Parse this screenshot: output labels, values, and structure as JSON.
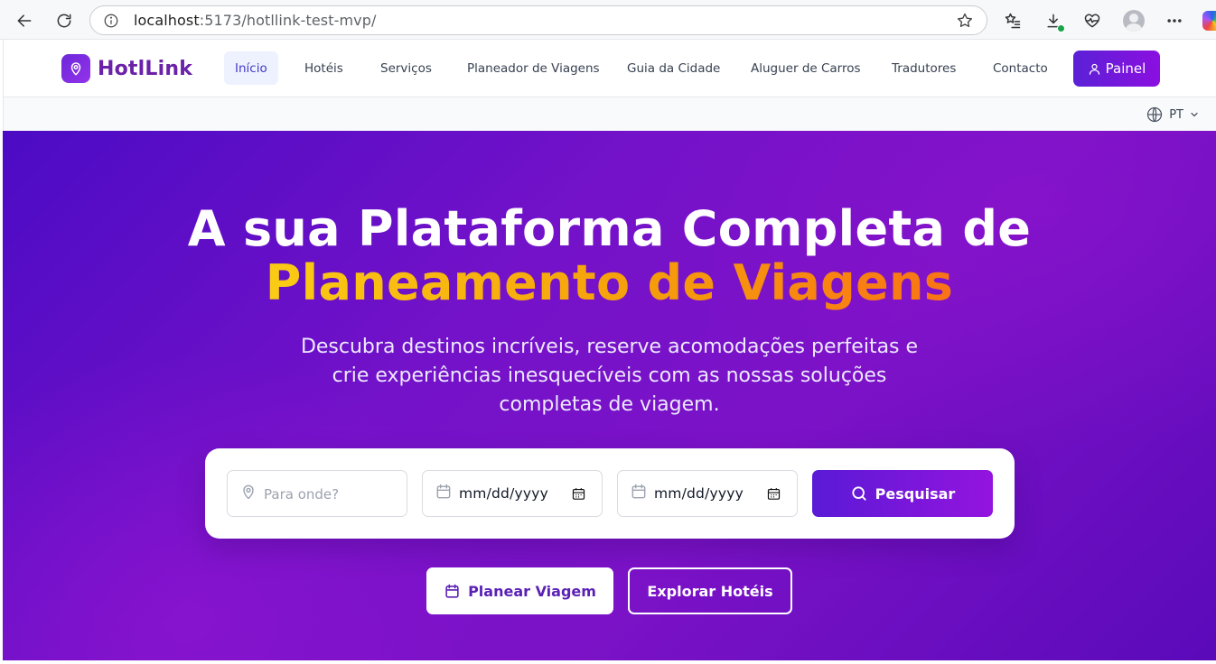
{
  "browser": {
    "url_host": "localhost",
    "url_path": ":5173/hotllink-test-mvp/"
  },
  "navbar": {
    "brand": "HotlLink",
    "links": [
      {
        "label": "Início",
        "active": true
      },
      {
        "label": "Hotéis",
        "active": false
      },
      {
        "label": "Serviços",
        "active": false
      },
      {
        "label": "Planeador de Viagens",
        "active": false
      },
      {
        "label": "Guia da Cidade",
        "active": false
      },
      {
        "label": "Aluguer de Carros",
        "active": false
      },
      {
        "label": "Tradutores",
        "active": false
      },
      {
        "label": "Contacto",
        "active": false
      }
    ],
    "dashboard_label": "Painel"
  },
  "language": {
    "current": "PT"
  },
  "hero": {
    "title_line1": "A sua Plataforma Completa de",
    "title_line2": "Planeamento de Viagens",
    "subtitle": "Descubra destinos incríveis, reserve acomodações perfeitas e crie experiências inesquecíveis com as nossas soluções completas de viagem."
  },
  "search": {
    "destination_placeholder": "Para onde?",
    "checkin_value": "mm/dd/yyyy",
    "checkout_value": "mm/dd/yyyy",
    "button_label": "Pesquisar"
  },
  "cta": {
    "primary_label": "Planear Viagem",
    "secondary_label": "Explorar Hotéis"
  },
  "colors": {
    "brand_purple": "#6d28d9",
    "hero_gradient_start": "#4c0bc4",
    "hero_gradient_end": "#7c12c7",
    "highlight_yellow": "#facc15",
    "highlight_orange": "#f97316"
  }
}
